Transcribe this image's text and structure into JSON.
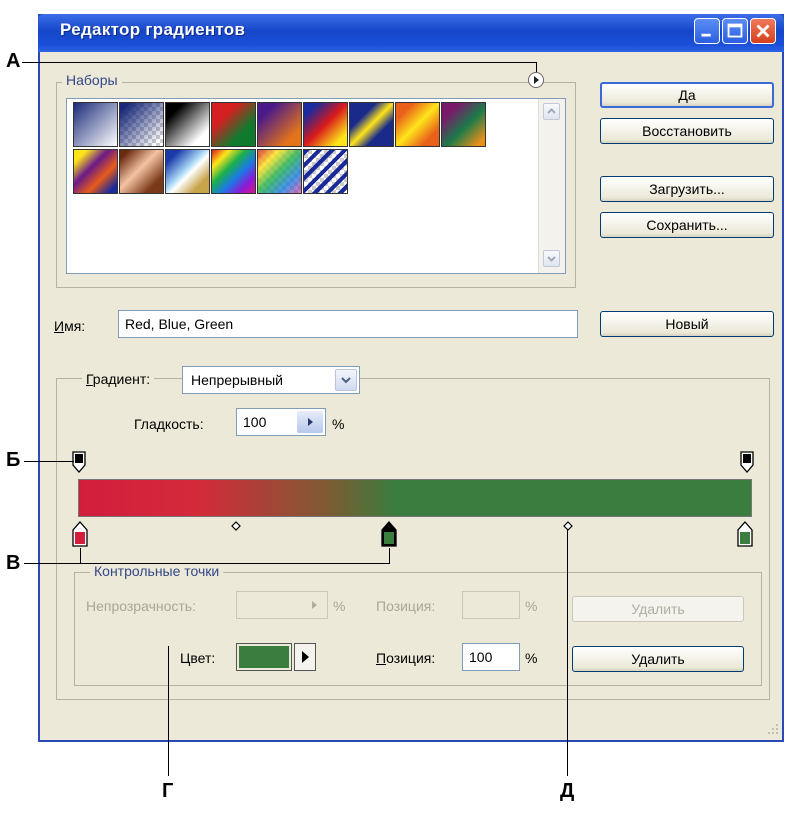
{
  "window": {
    "title": "Редактор градиентов"
  },
  "presets": {
    "group_label": "Наборы",
    "swatches": [
      {
        "name": "swatch-blue-white"
      },
      {
        "name": "swatch-blue-transparent"
      },
      {
        "name": "swatch-black-white"
      },
      {
        "name": "swatch-red-green"
      },
      {
        "name": "swatch-violet-orange"
      },
      {
        "name": "swatch-blue-red-yellow"
      },
      {
        "name": "swatch-blue-yellow-blue"
      },
      {
        "name": "swatch-orange-yellow-orange"
      },
      {
        "name": "swatch-violet-green-orange"
      },
      {
        "name": "swatch-yellow-violet-orange-blue"
      },
      {
        "name": "swatch-copper"
      },
      {
        "name": "swatch-chrome"
      },
      {
        "name": "swatch-spectrum"
      },
      {
        "name": "swatch-transparent-rainbow"
      },
      {
        "name": "swatch-transparent-stripes"
      }
    ]
  },
  "buttons": {
    "ok": "Да",
    "reset": "Восстановить",
    "load": "Загрузить...",
    "save": "Сохранить...",
    "new": "Новый"
  },
  "name_field": {
    "label": "Имя:",
    "value": "Red, Blue, Green"
  },
  "gradient": {
    "type_label": "Градиент:",
    "type_value": "Непрерывный",
    "smoothness_label": "Гладкость:",
    "smoothness_value": "100",
    "smoothness_unit": "%",
    "colors": [
      "#d21e3c",
      "#3b7d3e"
    ]
  },
  "stops": {
    "group_label": "Контрольные точки",
    "opacity_label": "Непрозрачность:",
    "opacity_value": "",
    "opacity_unit": "%",
    "opacity_position_label": "Позиция:",
    "opacity_position_value": "",
    "opacity_position_unit": "%",
    "opacity_delete": "Удалить",
    "color_label": "Цвет:",
    "color_value": "#3b7d3e",
    "color_position_label": "Позиция:",
    "color_position_value": "100",
    "color_position_unit": "%",
    "color_delete": "Удалить"
  },
  "annotations": {
    "a": "А",
    "b": "Б",
    "v": "В",
    "g": "Г",
    "d": "Д"
  }
}
